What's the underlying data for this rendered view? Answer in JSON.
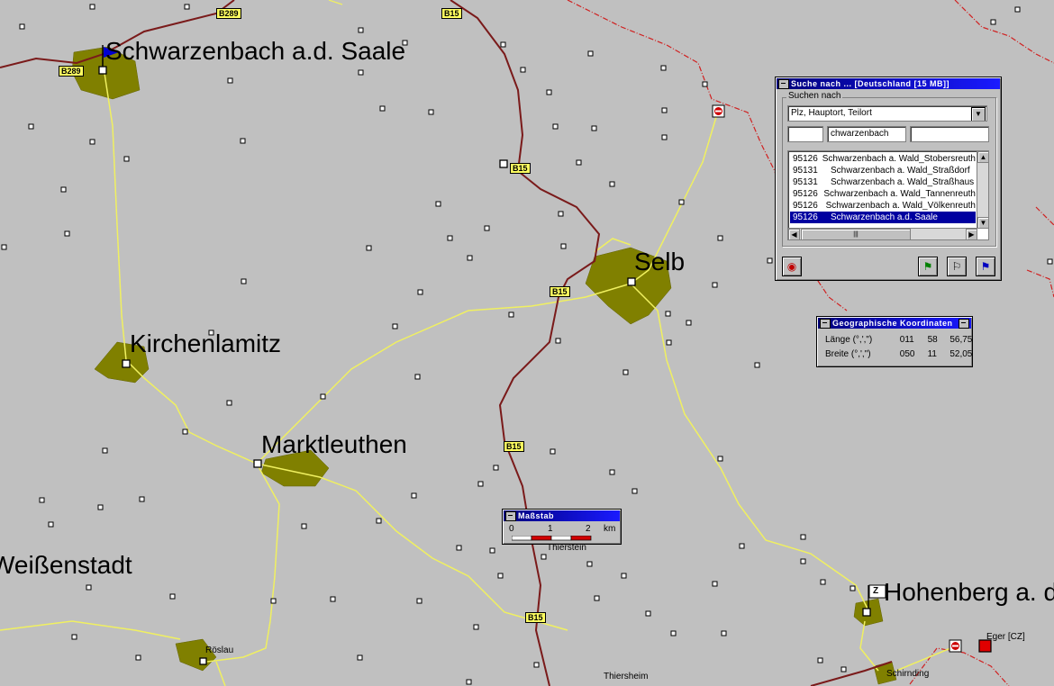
{
  "map": {
    "cities": [
      {
        "name": "Schwarzenbach a.d. Saale"
      },
      {
        "name": "Selb"
      },
      {
        "name": "Kirchenlamitz"
      },
      {
        "name": "Marktleuthen"
      },
      {
        "name": "Weißenstadt"
      },
      {
        "name": "Hohenberg a. d"
      }
    ],
    "small_places": [
      {
        "name": "Thierstein"
      },
      {
        "name": "Röslau"
      },
      {
        "name": "Thiersheim"
      },
      {
        "name": "Schirnding"
      },
      {
        "name": "Eger [CZ]"
      }
    ],
    "road_labels": [
      "B289",
      "B289",
      "B15",
      "B15",
      "B15",
      "B15",
      "B15"
    ],
    "colors": {
      "background": "#c0c0c0",
      "town_area": "#808000",
      "yellow_road": "#f0f060",
      "federal_road": "#7a1a1a",
      "border": "#d02020"
    }
  },
  "search_window": {
    "title": "Suche nach ... [Deutschland [15 MB]]",
    "group_label": "Suchen nach",
    "search_type": "Plz, Hauptort, Teilort",
    "field1": "",
    "field2": "chwarzenbach",
    "field3": "",
    "results": [
      {
        "plz": "95126",
        "name": "Schwarzenbach a. Wald_Stobersreuth"
      },
      {
        "plz": "95131",
        "name": "Schwarzenbach a. Wald_Straßdorf"
      },
      {
        "plz": "95131",
        "name": "Schwarzenbach a. Wald_Straßhaus"
      },
      {
        "plz": "95126",
        "name": "Schwarzenbach a. Wald_Tannenreuth"
      },
      {
        "plz": "95126",
        "name": "Schwarzenbach a. Wald_Völkenreuth"
      },
      {
        "plz": "95126",
        "name": "Schwarzenbach a.d. Saale"
      }
    ],
    "selected_index": 5
  },
  "coords_window": {
    "title": "Geographische Koordinaten",
    "laenge_label": "Länge (°,',\")",
    "laenge_deg": "011",
    "laenge_min": "58",
    "laenge_sec": "56,75",
    "breite_label": "Breite (°,',\")",
    "breite_deg": "050",
    "breite_min": "11",
    "breite_sec": "52,05"
  },
  "scale_window": {
    "title": "Maßstab",
    "tick0": "0",
    "tick1": "1",
    "tick2": "2",
    "unit": "km"
  }
}
